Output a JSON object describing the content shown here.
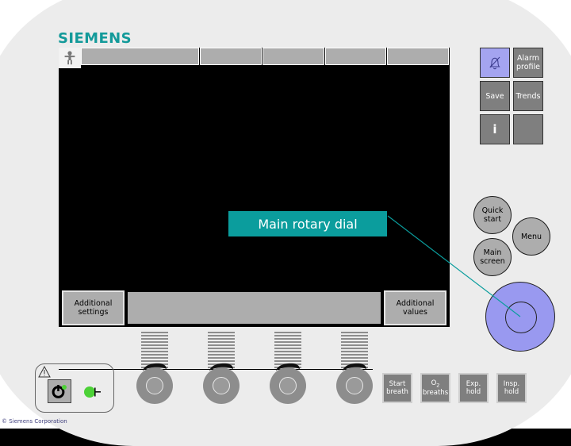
{
  "brand": "SIEMENS",
  "callout": {
    "label": "Main rotary dial",
    "background": "#0b9d9d",
    "text_color": "#ffffff"
  },
  "screen": {
    "background": "#000000",
    "patient_icon": "patient-icon",
    "tabs": [
      "",
      "",
      "",
      "",
      ""
    ],
    "softkeys": {
      "left_label": "Additional settings",
      "right_label": "Additional values",
      "center_label": ""
    }
  },
  "side_buttons": [
    {
      "name": "alarm-silence",
      "label": "",
      "icon": "bell-crossed-icon",
      "background": "#a4a4f0"
    },
    {
      "name": "alarm-profile",
      "label": "Alarm profile",
      "background": "#7f7f7f"
    },
    {
      "name": "save",
      "label": "Save",
      "background": "#7f7f7f"
    },
    {
      "name": "trends",
      "label": "Trends",
      "background": "#7f7f7f"
    },
    {
      "name": "info",
      "label": "i",
      "background": "#7f7f7f"
    },
    {
      "name": "blank",
      "label": "",
      "background": "#7f7f7f"
    }
  ],
  "round_buttons": [
    {
      "name": "quick-start",
      "label": "Quick start"
    },
    {
      "name": "menu",
      "label": "Menu"
    },
    {
      "name": "main-screen",
      "label": "Main screen"
    }
  ],
  "rotary_dial": {
    "name": "main-rotary-dial",
    "color": "#9999f0"
  },
  "action_buttons": [
    {
      "name": "start-breath",
      "line1": "Start",
      "line2": "breath"
    },
    {
      "name": "o2-breaths",
      "line1": "O",
      "sub": "2",
      "line2": "breaths"
    },
    {
      "name": "exp-hold",
      "line1": "Exp.",
      "line2": "hold"
    },
    {
      "name": "insp-hold",
      "line1": "Insp.",
      "line2": "hold"
    }
  ],
  "power_panel": {
    "warning_icon": "warning-triangle-icon",
    "power_icon": "power-button-icon",
    "mains_icon": "mains-indicator-icon",
    "led_color": "#4cd137"
  },
  "ports": {
    "count": 4,
    "label": "breathing-circuit-port"
  },
  "watermark": "© Siemens Corporation"
}
